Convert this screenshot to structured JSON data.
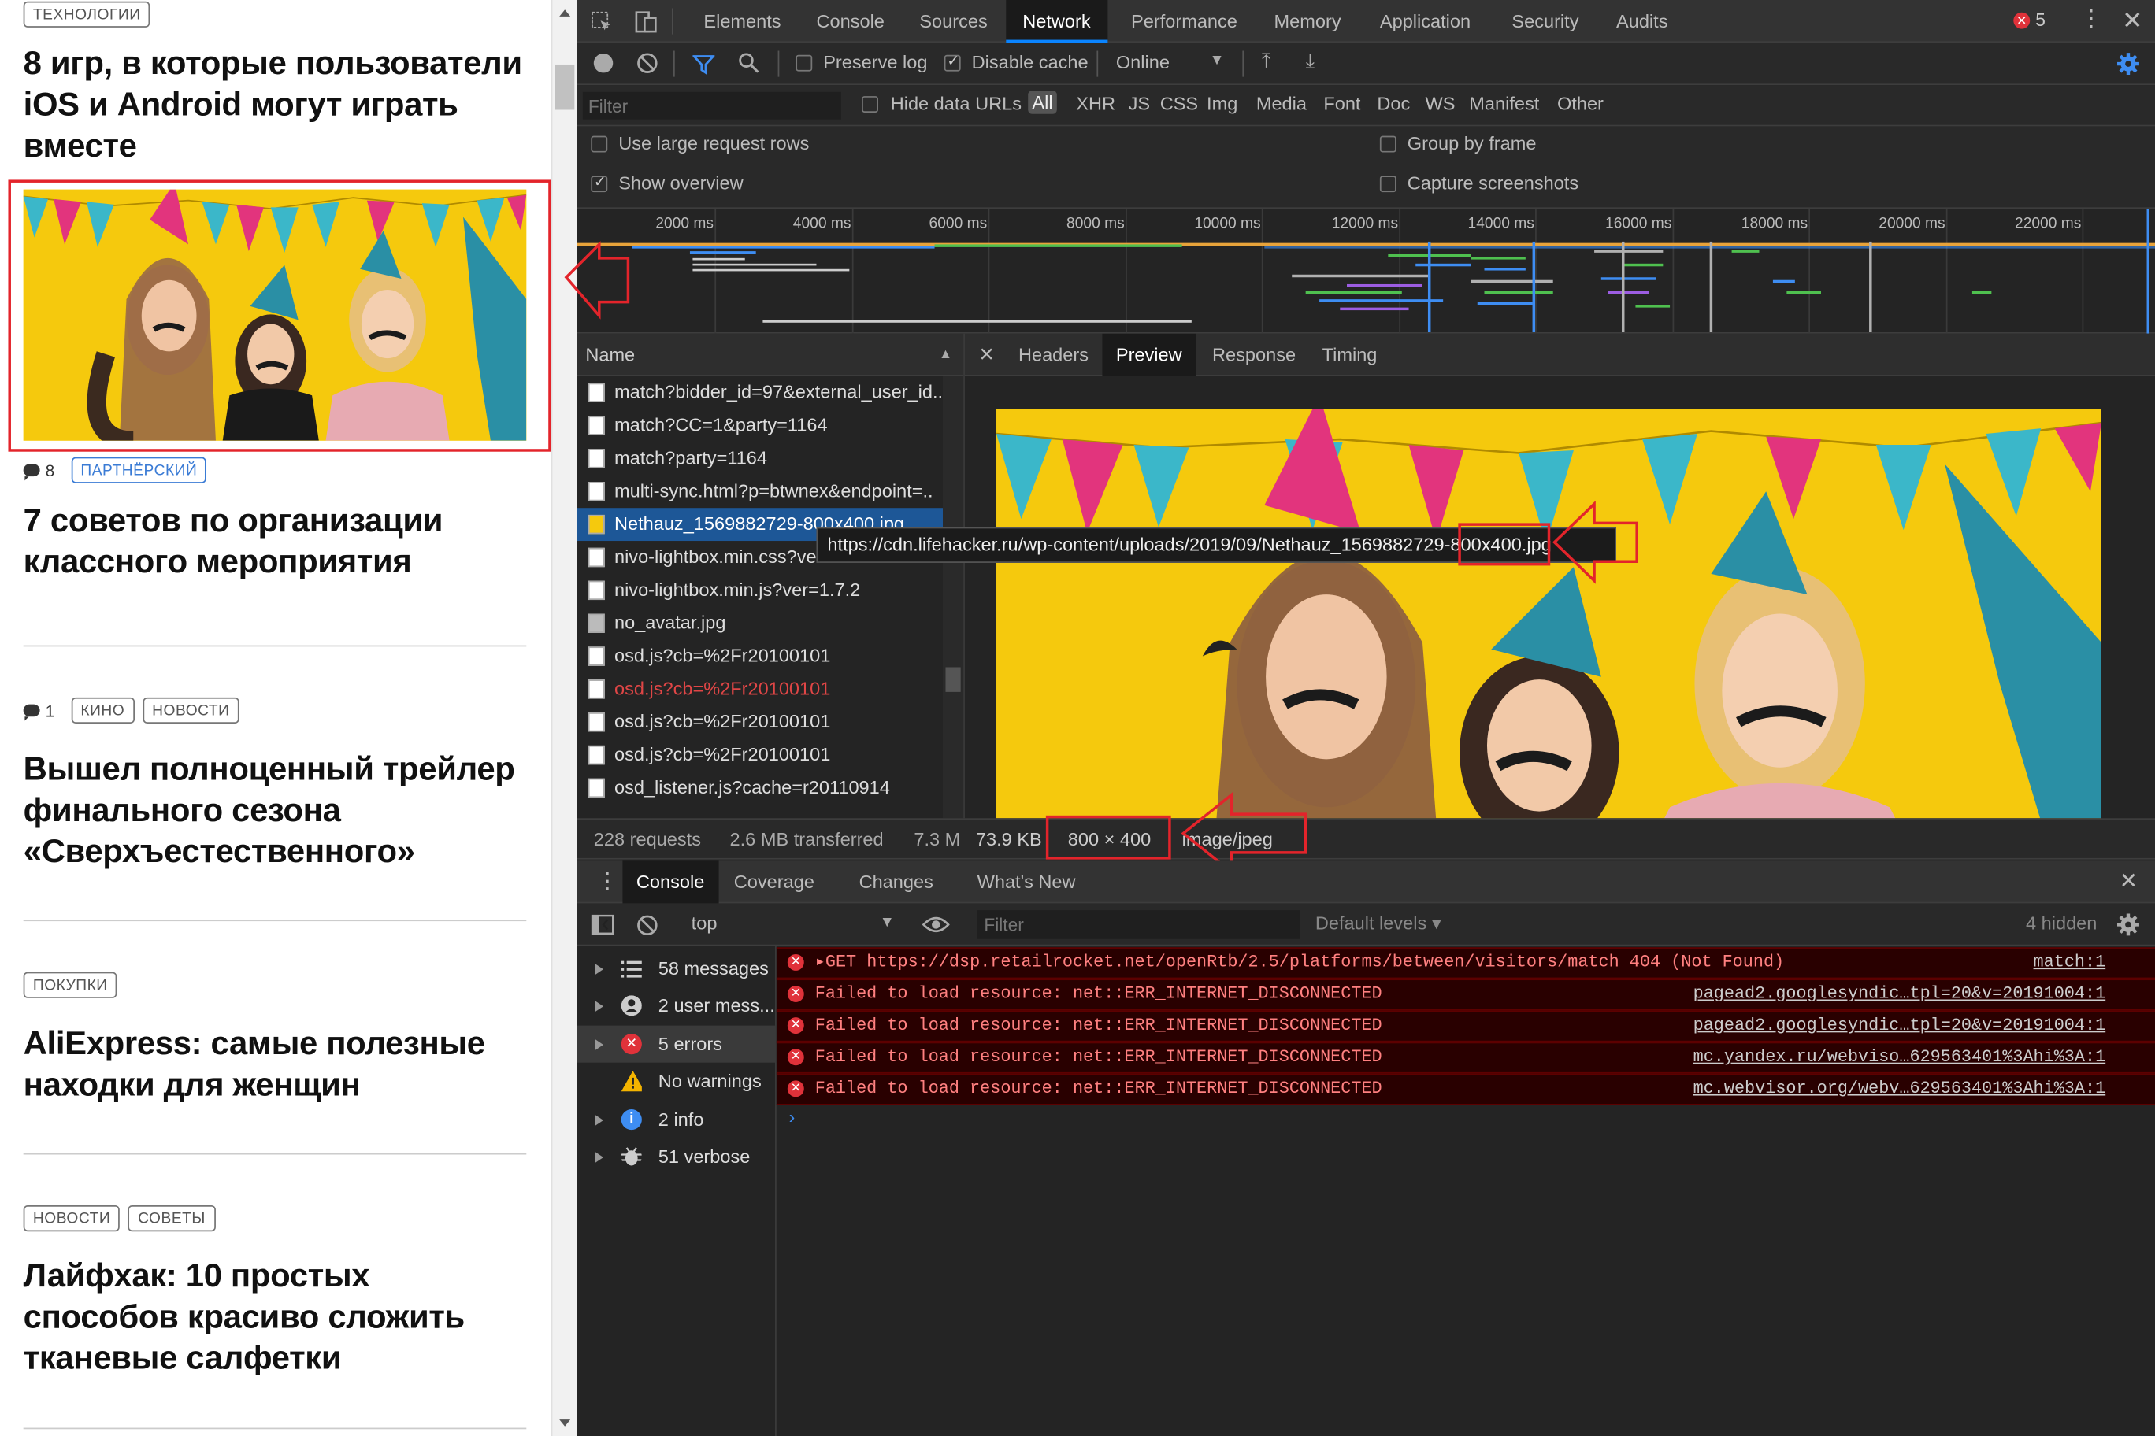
{
  "site": {
    "articles": [
      {
        "tags": [
          "ТЕХНОЛОГИИ"
        ],
        "title": "8 игр, в которые пользователи iOS и Android могут играть вместе"
      },
      {
        "comments": "8",
        "tags": [
          "ПАРТНЁРСКИЙ"
        ],
        "title": "7 советов по организации классного мероприятия"
      },
      {
        "comments": "1",
        "tags": [
          "КИНО",
          "НОВОСТИ"
        ],
        "title": "Вышел полноценный трейлер финального сезона «Сверхъестественного»"
      },
      {
        "tags": [
          "ПОКУПКИ"
        ],
        "title": "AliExpress: самые полезные находки для женщин"
      },
      {
        "tags": [
          "НОВОСТИ",
          "СОВЕТЫ"
        ],
        "title": "Лайфхак: 10 простых способов красиво сложить тканевые салфетки"
      }
    ]
  },
  "devtools": {
    "tabs": [
      "Elements",
      "Console",
      "Sources",
      "Network",
      "Performance",
      "Memory",
      "Application",
      "Security",
      "Audits"
    ],
    "active_tab": "Network",
    "error_count": "5",
    "toolbar": {
      "preserve_log": "Preserve log",
      "disable_cache": "Disable cache",
      "throttling": "Online"
    },
    "filter": {
      "placeholder": "Filter",
      "hide_data_urls": "Hide data URLs",
      "types": [
        "All",
        "XHR",
        "JS",
        "CSS",
        "Img",
        "Media",
        "Font",
        "Doc",
        "WS",
        "Manifest",
        "Other"
      ]
    },
    "options": {
      "large_rows": "Use large request rows",
      "group_by_frame": "Group by frame",
      "show_overview": "Show overview",
      "capture_screenshots": "Capture screenshots"
    },
    "overview_ticks": [
      "2000 ms",
      "4000 ms",
      "6000 ms",
      "8000 ms",
      "10000 ms",
      "12000 ms",
      "14000 ms",
      "16000 ms",
      "18000 ms",
      "20000 ms",
      "22000 ms"
    ],
    "name_header": "Name",
    "requests": [
      "match?bidder_id=97&external_user_id..",
      "match?CC=1&party=1164",
      "match?party=1164",
      "multi-sync.html?p=btwnex&endpoint=..",
      "Nethauz_1569882729-800x400.jpg",
      "nivo-lightbox.min.css?ve",
      "nivo-lightbox.min.js?ver=1.7.2",
      "no_avatar.jpg",
      "osd.js?cb=%2Fr20100101",
      "osd.js?cb=%2Fr20100101",
      "osd.js?cb=%2Fr20100101",
      "osd.js?cb=%2Fr20100101",
      "osd_listener.js?cache=r20110914"
    ],
    "tooltip": "https://cdn.lifehacker.ru/wp-content/uploads/2019/09/Nethauz_1569882729-800x400.jpg",
    "detail_tabs": [
      "Headers",
      "Preview",
      "Response",
      "Timing"
    ],
    "active_detail_tab": "Preview",
    "status": {
      "requests": "228 requests",
      "transferred": "2.6 MB transferred",
      "resources": "7.3 M",
      "size": "73.9 KB",
      "dimensions": "800 × 400",
      "mime": "image/jpeg"
    },
    "drawer_tabs": [
      "Console",
      "Coverage",
      "Changes",
      "What's New"
    ],
    "console": {
      "context": "top",
      "filter_placeholder": "Filter",
      "levels": "Default levels ▾",
      "hidden": "4 hidden",
      "sidebar": [
        {
          "label": "58 messages",
          "icon": "list-icon"
        },
        {
          "label": "2 user mess...",
          "icon": "user-icon"
        },
        {
          "label": "5 errors",
          "icon": "error-icon"
        },
        {
          "label": "No warnings",
          "icon": "warning-icon"
        },
        {
          "label": "2 info",
          "icon": "info-icon"
        },
        {
          "label": "51 verbose",
          "icon": "verbose-icon"
        }
      ],
      "messages": [
        {
          "text": "▸GET https://dsp.retailrocket.net/openRtb/2.5/platforms/between/visitors/match 404 (Not Found)",
          "source": "match:1"
        },
        {
          "text": "Failed to load resource: net::ERR_INTERNET_DISCONNECTED",
          "source": "pagead2.googlesyndic…tpl=20&v=20191004:1"
        },
        {
          "text": "Failed to load resource: net::ERR_INTERNET_DISCONNECTED",
          "source": "pagead2.googlesyndic…tpl=20&v=20191004:1"
        },
        {
          "text": "Failed to load resource: net::ERR_INTERNET_DISCONNECTED",
          "source": "mc.yandex.ru/webviso…629563401%3Ahi%3A:1"
        },
        {
          "text": "Failed to load resource: net::ERR_INTERNET_DISCONNECTED",
          "source": "mc.webvisor.org/webv…629563401%3Ahi%3A:1"
        }
      ]
    }
  }
}
